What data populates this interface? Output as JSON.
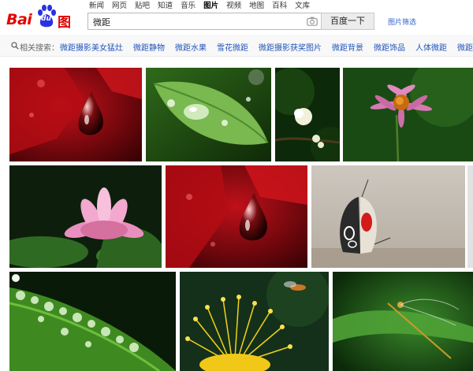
{
  "header": {
    "logo_text_bai": "Bai",
    "logo_text_du": "du",
    "logo_text_tupian": "图片",
    "nav": [
      "新闻",
      "网页",
      "贴吧",
      "知道",
      "音乐",
      "图片",
      "视频",
      "地图",
      "百科",
      "文库"
    ],
    "active_nav_index": 5,
    "search_value": "微距",
    "search_button_label": "百度一下",
    "filter_link_label": "图片筛选"
  },
  "related": {
    "label": "相关搜索：",
    "items": [
      "微距摄影美女猛灶",
      "微距静物",
      "微距水果",
      "雪花微距",
      "微距摄影获奖图片",
      "微距背景",
      "微距饰品",
      "人体微距",
      "微距头"
    ]
  },
  "images": [
    {
      "subject": "red-leaf-water-drop"
    },
    {
      "subject": "green-leaf-water-drops"
    },
    {
      "subject": "white-flower-bud"
    },
    {
      "subject": "pink-daisy"
    },
    {
      "subject": "pink-lotus"
    },
    {
      "subject": "red-leaf-water-drop"
    },
    {
      "subject": "butterfly"
    },
    {
      "subject": "green-leaf-dew"
    },
    {
      "subject": "yellow-flower-hoverfly"
    },
    {
      "subject": "damselfly-on-leaf"
    }
  ],
  "colors": {
    "brand_red": "#e10601",
    "link_blue": "#2255bb",
    "filter_blue": "#3366cc"
  }
}
